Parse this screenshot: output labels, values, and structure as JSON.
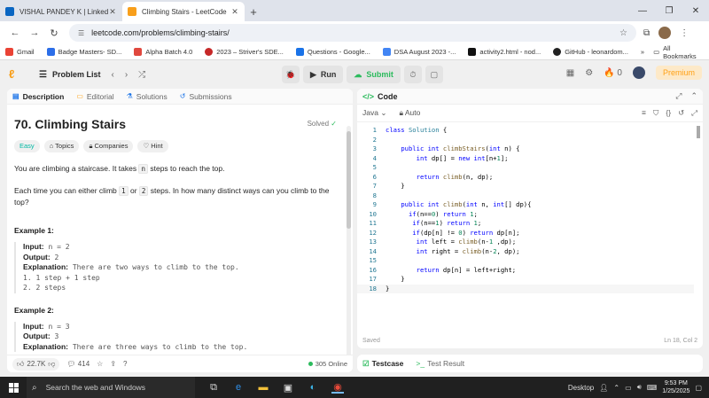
{
  "browser": {
    "tabs": [
      {
        "title": "VISHAL PANDEY K | LinkedIn",
        "active": false
      },
      {
        "title": "Climbing Stairs - LeetCode",
        "active": true
      }
    ],
    "url": "leetcode.com/problems/climbing-stairs/",
    "bookmarks": [
      "Gmail",
      "Badge Masters- SD...",
      "Alpha Batch 4.0",
      "2023 – Striver's SDE...",
      "Questions - Google...",
      "DSA August 2023 -...",
      "activity2.html - nod...",
      "GitHub - leonardom..."
    ],
    "all_bookmarks": "All Bookmarks"
  },
  "lc_nav": {
    "problem_list": "Problem List",
    "run": "Run",
    "submit": "Submit",
    "streak": "0",
    "premium": "Premium"
  },
  "left": {
    "tabs": [
      "Description",
      "Editorial",
      "Solutions",
      "Submissions"
    ],
    "title": "70. Climbing Stairs",
    "solved": "Solved",
    "chips": [
      "Easy",
      "Topics",
      "Companies",
      "Hint"
    ],
    "para1_a": "You are climbing a staircase. It takes ",
    "para1_code": "n",
    "para1_b": " steps to reach the top.",
    "para2_a": "Each time you can either climb ",
    "para2_c1": "1",
    "para2_or": " or ",
    "para2_c2": "2",
    "para2_b": " steps. In how many distinct ways can you climb to the top?",
    "ex1": {
      "heading": "Example 1:",
      "input_label": "Input:",
      "input": "n = 2",
      "output_label": "Output:",
      "output": "2",
      "expl_label": "Explanation:",
      "expl": "There are two ways to climb to the top.",
      "lines": [
        "1. 1 step + 1 step",
        "2. 2 steps"
      ]
    },
    "ex2": {
      "heading": "Example 2:",
      "input_label": "Input:",
      "input": "n = 3",
      "output_label": "Output:",
      "output": "3",
      "expl_label": "Explanation:",
      "expl": "There are three ways to climb to the top."
    },
    "footer": {
      "likes": "22.7K",
      "comments": "414",
      "online": "305 Online"
    }
  },
  "editor": {
    "header": "Code",
    "language": "Java",
    "mode": "Auto",
    "lines": [
      "class Solution {",
      "",
      "    public int climbStairs(int n) {",
      "        int dp[] = new int[n+1];",
      "",
      "        return climb(n, dp);",
      "    }",
      "",
      "    public int climb(int n, int[] dp){",
      "      if(n==0) return 1;",
      "       if(n==1) return 1;",
      "       if(dp[n] != 0) return dp[n];",
      "        int left = climb(n-1 ,dp);",
      "        int right = climb(n-2, dp);",
      "",
      "        return dp[n] = left+right;",
      "    }",
      "}"
    ],
    "status_left": "Saved",
    "status_right": "Ln 18, Col 2"
  },
  "testpanel": {
    "testcase": "Testcase",
    "result": "Test Result"
  },
  "taskbar": {
    "search_placeholder": "Search the web and Windows",
    "desktop": "Desktop",
    "time": "9:53 PM",
    "date": "1/25/2025"
  }
}
